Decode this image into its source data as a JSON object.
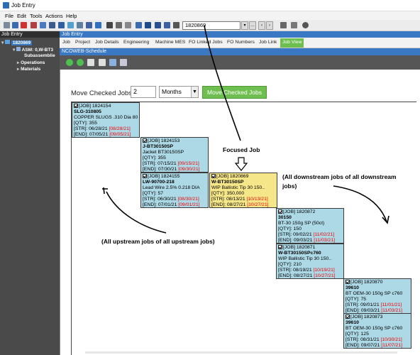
{
  "window": {
    "title": "Job Entry"
  },
  "menu": [
    "File",
    "Edit",
    "Tools",
    "Actions",
    "Help"
  ],
  "toolbar": {
    "job_value": "1820869"
  },
  "left_panel": {
    "header": "Job Entry",
    "job": "1820869",
    "asm": "ASM: 0,W-BT3",
    "items": [
      "Subassemblie",
      "Operations",
      "Materials"
    ]
  },
  "right_panel": {
    "header": "Job Entry",
    "tabs": [
      "Job",
      "Project",
      "Job Details",
      "Engineering",
      "Machine MES",
      "FO Linked Jobs",
      "FO Numbers",
      "Job Link",
      "Job View"
    ],
    "active_tab": "Job View",
    "sub_header": "NCOWEB-Schedule"
  },
  "move": {
    "label": "Move Checked Jobs:",
    "value": "2",
    "unit": "Months",
    "button": "Move Checked Jobs"
  },
  "jobs": [
    {
      "id": "[JOB] 1824154",
      "part": "SLG-310805",
      "desc": "COPPER SLUGS .310 Dia 80..",
      "qty": "[QTY]: 355",
      "str": "06/28/21",
      "str2": "[08/28/21]",
      "end": "07/05/21",
      "end2": "[09/05/21]"
    },
    {
      "id": "[JOB] 1824153",
      "part": "J-BT30150SP",
      "desc": "Jacket BT30150SP",
      "qty": "[QTY]: 355",
      "str": "07/15/21",
      "str2": "[09/15/21]",
      "end": "07/30/21",
      "end2": "[09/30/21]"
    },
    {
      "id": "[JOB] 1824155",
      "part": "LW-90700-218",
      "desc": "Lead Wire 2.5% 0.218 DIA",
      "qty": "[QTY]: 57",
      "str": "06/30/21",
      "str2": "[08/30/21]",
      "end": "07/01/21",
      "end2": "[09/01/21]"
    },
    {
      "id": "[JOB] 1820869",
      "part": "W-BT30150SP",
      "desc": "WIP Ballistic Tip 30 150..",
      "qty": "[QTY]: 350,000",
      "str": "08/13/21",
      "str2": "[10/13/21]",
      "end": "08/27/21",
      "end2": "[10/27/21]"
    },
    {
      "id": "[JOB] 1820872",
      "part": "30150",
      "desc": "BT-30 150g SP (50ct)",
      "qty": "[QTY]: 150",
      "str": "09/02/21",
      "str2": "[11/02/21]",
      "end": "09/03/21",
      "end2": "[11/03/21]"
    },
    {
      "id": "[JOB] 1820871",
      "part": "W-BT30150SPc760",
      "desc": "WIP Ballistic Tip 30 150..",
      "qty": "[QTY]: 210",
      "str": "08/19/21",
      "str2": "[10/19/21]",
      "end": "08/27/21",
      "end2": "[10/27/21]"
    },
    {
      "id": "[JOB] 1820870",
      "part": "39610",
      "desc": "BT OEM-30 150g SP c760",
      "qty": "[QTY]: 75",
      "str": "09/01/21",
      "str2": "[11/01/21]",
      "end": "09/03/21",
      "end2": "[11/03/21]"
    },
    {
      "id": "[JOB] 1820873",
      "part": "39610",
      "desc": "BT OEM-30 150g SP c760",
      "qty": "[QTY]: 125",
      "str": "08/31/21",
      "str2": "[10/30/21]",
      "end": "09/07/21",
      "end2": "[11/07/21]"
    }
  ],
  "annotations": {
    "focused": "Focused Job",
    "upstream": "(All upstream jobs of all upstream jobs)",
    "downstream": "(All downstream jobs of all downstream jobs)"
  },
  "labels": {
    "str": "[STR]: ",
    "end": "[END]: "
  }
}
